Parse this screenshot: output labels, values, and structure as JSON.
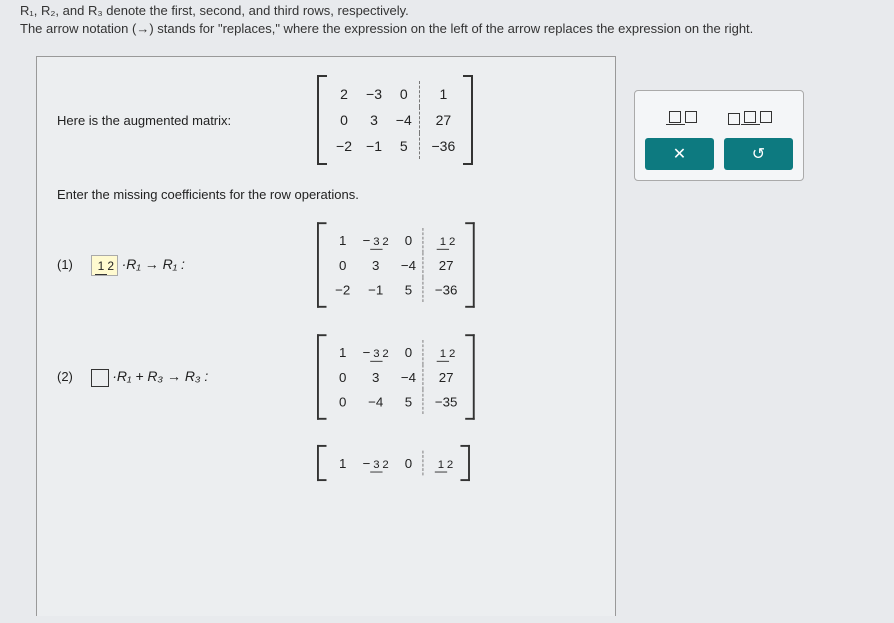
{
  "header": {
    "line1_fragment": "denote the first, second, and third rows, respectively.",
    "line2": "The arrow notation (→) stands for \"replaces,\" where the expression on the left of the arrow replaces the expression on the right."
  },
  "intro_label": "Here is the augmented matrix:",
  "instruction": "Enter the missing coefficients for the row operations.",
  "matrices": {
    "m0": {
      "r1": {
        "a": "2",
        "b": "−3",
        "c": "0",
        "d": "1"
      },
      "r2": {
        "a": "0",
        "b": "3",
        "c": "−4",
        "d": "27"
      },
      "r3": {
        "a": "−2",
        "b": "−1",
        "c": "5",
        "d": "−36"
      }
    },
    "m1": {
      "r1": {
        "a": "1",
        "b_num": "3",
        "b_den": "2",
        "b_sign": "−",
        "c": "0",
        "d_num": "1",
        "d_den": "2"
      },
      "r2": {
        "a": "0",
        "b": "3",
        "c": "−4",
        "d": "27"
      },
      "r3": {
        "a": "−2",
        "b": "−1",
        "c": "5",
        "d": "−36"
      }
    },
    "m2": {
      "r1": {
        "a": "1",
        "b_num": "3",
        "b_den": "2",
        "b_sign": "−",
        "c": "0",
        "d_num": "1",
        "d_den": "2"
      },
      "r2": {
        "a": "0",
        "b": "3",
        "c": "−4",
        "d": "27"
      },
      "r3": {
        "a": "0",
        "b": "−4",
        "c": "5",
        "d": "−35"
      }
    },
    "m3": {
      "r1": {
        "a": "1",
        "b_num": "3",
        "b_den": "2",
        "b_sign": "−",
        "c": "0",
        "d_num": "1",
        "d_den": "2"
      }
    }
  },
  "steps": {
    "s1": {
      "label": "(1)",
      "coef_num": "1",
      "coef_den": "2",
      "expr": "·R₁ → R₁ :"
    },
    "s2": {
      "label": "(2)",
      "expr": "·R₁ + R₃ → R₃ :"
    }
  },
  "toolbox": {
    "frac_tool": {
      "num": "□",
      "den": "□"
    },
    "mixedfrac_tool": {
      "whole": "□",
      "num": "□",
      "den": "□"
    },
    "close": "✕",
    "reset": "↺"
  }
}
